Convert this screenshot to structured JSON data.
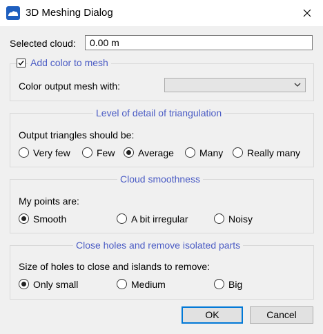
{
  "window": {
    "title": "3D Meshing Dialog",
    "app_icon": "meshlab-icon",
    "close_icon": "close-icon"
  },
  "selected_cloud": {
    "label": "Selected cloud:",
    "value": "0.00 m"
  },
  "color_group": {
    "checkbox_label": "Add color to mesh",
    "checked": true,
    "combo_label": "Color output mesh with:",
    "combo_value": ""
  },
  "detail_group": {
    "title": "Level of detail of triangulation",
    "prompt": "Output triangles should be:",
    "options": [
      "Very few",
      "Few",
      "Average",
      "Many",
      "Really many"
    ],
    "selected": "Average"
  },
  "smoothness_group": {
    "title": "Cloud smoothness",
    "prompt": "My points are:",
    "options": [
      "Smooth",
      "A bit irregular",
      "Noisy"
    ],
    "selected": "Smooth"
  },
  "holes_group": {
    "title": "Close holes and remove isolated parts",
    "prompt": "Size of holes to close and islands to remove:",
    "options": [
      "Only small",
      "Medium",
      "Big"
    ],
    "selected": "Only small"
  },
  "buttons": {
    "ok": "OK",
    "cancel": "Cancel"
  },
  "colors": {
    "group_title": "#4a5bc4",
    "default_button_border": "#0078d7"
  }
}
